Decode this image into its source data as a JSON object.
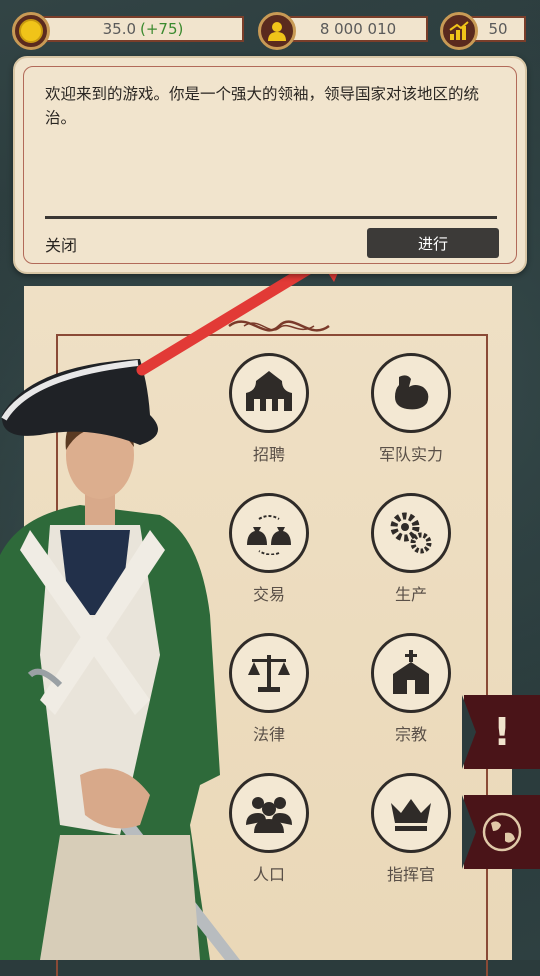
{
  "top_bar": {
    "gold": {
      "value": "35.0",
      "gain": "(+75)"
    },
    "population": {
      "value": "8 000 010"
    },
    "growth": {
      "value": "50"
    }
  },
  "dialog": {
    "message": "欢迎来到的游戏。你是一个强大的领袖，领导国家对该地区的统治。",
    "close_label": "关闭",
    "proceed_label": "进行"
  },
  "menu": {
    "items": [
      {
        "label": "招聘",
        "icon": "tent-icon"
      },
      {
        "label": "军队实力",
        "icon": "muscle-arm-icon"
      },
      {
        "label": "交易",
        "icon": "money-bags-exchange-icon"
      },
      {
        "label": "生产",
        "icon": "gears-icon"
      },
      {
        "label": "法律",
        "icon": "scales-icon"
      },
      {
        "label": "宗教",
        "icon": "church-icon"
      },
      {
        "label": "人口",
        "icon": "people-group-icon"
      },
      {
        "label": "指挥官",
        "icon": "crown-icon"
      }
    ]
  },
  "side_flags": {
    "alert": "!"
  },
  "colors": {
    "gain": "#3b8a2e",
    "dialog_bg": "#f1e4cd",
    "flag": "#4a1418",
    "arrow": "#e23a36"
  }
}
